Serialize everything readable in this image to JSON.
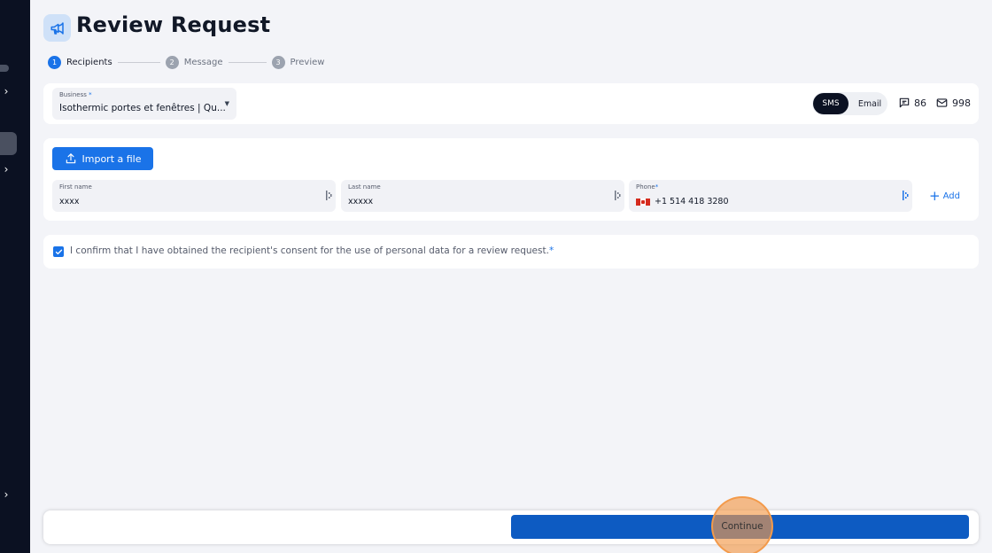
{
  "page": {
    "title": "Review Request",
    "title_icon": "megaphone-icon"
  },
  "stepper": [
    {
      "num": "1",
      "label": "Recipients",
      "active": true
    },
    {
      "num": "2",
      "label": "Message",
      "active": false
    },
    {
      "num": "3",
      "label": "Preview",
      "active": false
    }
  ],
  "business": {
    "label": "Business",
    "required_mark": "*",
    "value": "Isothermic portes et fenêtres | Qu..."
  },
  "channel_toggle": {
    "sms_label": "SMS",
    "email_label": "Email",
    "selected": "SMS"
  },
  "credits": {
    "sms_count": "86",
    "email_count": "998",
    "sms_icon": "chat-bubble-icon",
    "email_icon": "envelope-icon"
  },
  "recipients": {
    "import_label": "Import a file",
    "first_name": {
      "label": "First name",
      "value": "xxxx"
    },
    "last_name": {
      "label": "Last name",
      "value": "xxxxx"
    },
    "phone": {
      "label": "Phone",
      "required_mark": "*",
      "value": "+1 514 418 3280",
      "country_flag": "canada-flag-icon"
    },
    "add_label": "Add"
  },
  "consent": {
    "checked": true,
    "text": "I confirm that I have obtained the recipient's consent for the use of personal data for a review request.",
    "required_mark": "*"
  },
  "footer": {
    "continue_label": "Continue"
  },
  "colors": {
    "accent": "#1a73e8",
    "sidebar": "#0b1122",
    "continue": "#0d5bc2",
    "click_highlight": "#f39a4a"
  }
}
